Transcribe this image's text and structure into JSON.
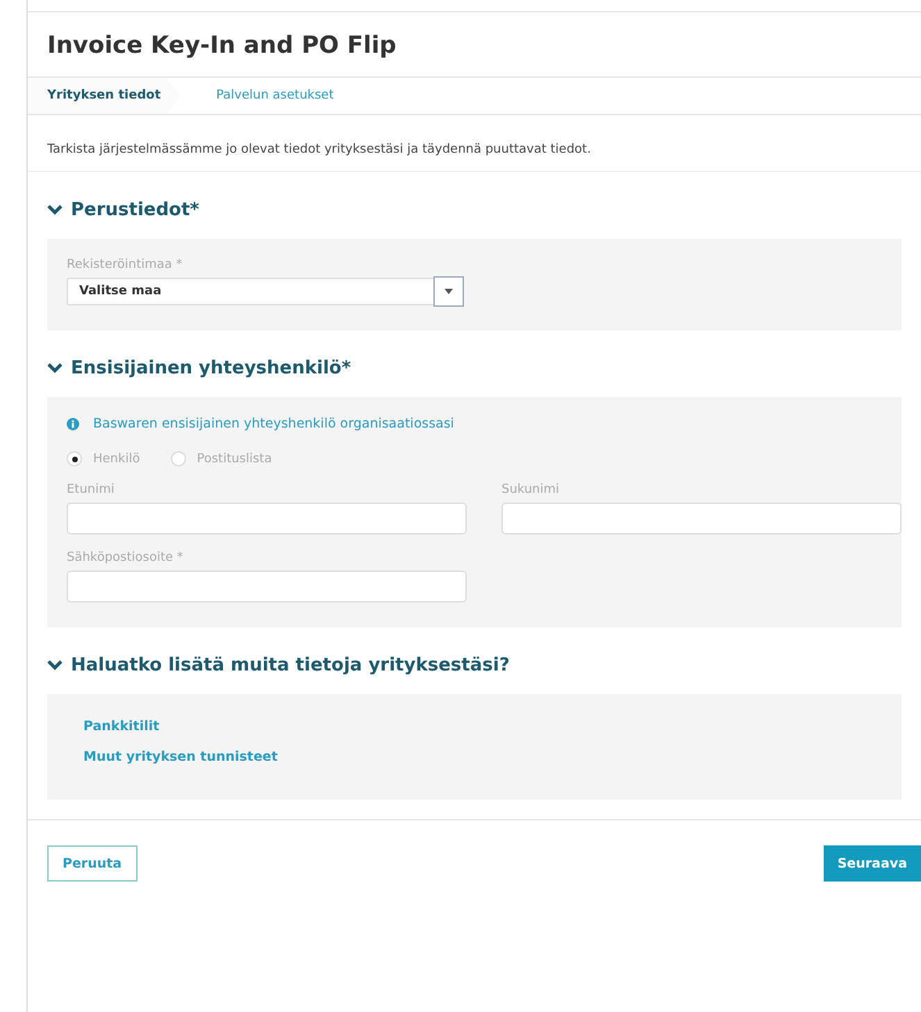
{
  "window": {
    "title": "Invoice Key-In and PO Flip"
  },
  "tabs": [
    {
      "label": "Yrityksen tiedot",
      "selected": true
    },
    {
      "label": "Palvelun asetukset",
      "selected": false
    }
  ],
  "intro": "Tarkista järjestelmässämme jo olevat tiedot yrityksestäsi ja täydennä puuttavat tiedot.",
  "sections": [
    {
      "title": "Perustiedot*",
      "expanded": true,
      "kind": "basic",
      "country": {
        "label": "Rekisteröintimaa *",
        "value": "Valitse maa"
      }
    },
    {
      "title": "Ensisijainen yhteyshenkilö*",
      "expanded": true,
      "kind": "contact",
      "info": "Baswaren ensisijainen yhteyshenkilö organisaatiossasi",
      "radios": [
        {
          "label": "Henkilö",
          "selected": true
        },
        {
          "label": "Postituslista",
          "selected": false
        }
      ],
      "fields": [
        {
          "label": "Etunimi"
        },
        {
          "label": "Sukunimi"
        },
        {
          "label": "Sähköpostiosoite *"
        }
      ]
    },
    {
      "title": "Haluatko lisätä muita tietoja yrityksestäsi?",
      "expanded": true,
      "kind": "links",
      "links": [
        "Pankkitilit",
        "Muut yrityksen tunnisteet"
      ]
    }
  ],
  "buttons": {
    "cancel": "Peruuta",
    "next": "Seuraava"
  }
}
